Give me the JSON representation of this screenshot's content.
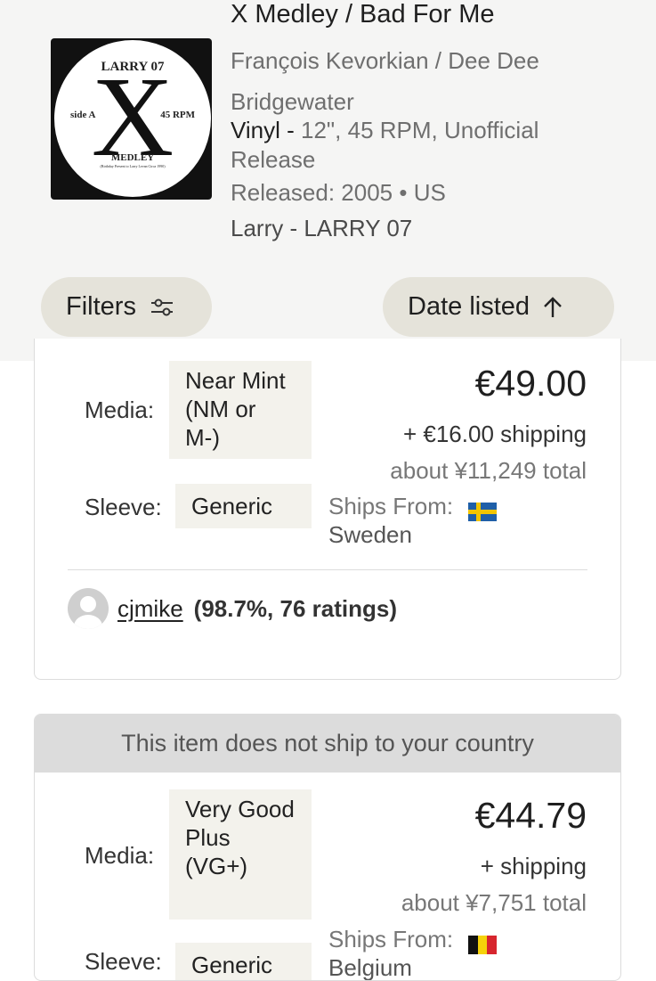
{
  "release": {
    "cover": {
      "catalog": "LARRY 07",
      "letter": "X",
      "side": "side A",
      "rpm": "45 RPM",
      "title": "MEDLEY",
      "fine_print": "(Birthday Present to Larry Levan Circa 1990)"
    },
    "title": "X Medley / Bad For Me",
    "artist_line1": "François Kevorkian / Dee Dee",
    "artist_line2": "Bridgewater",
    "format_main": "Vinyl -",
    "format_rest": "12\", 45 RPM, Unofficial Release",
    "released": "Released: 2005 • US",
    "label": "Larry - LARRY 07"
  },
  "controls": {
    "filters_label": "Filters",
    "filters_icon": "sliders-icon",
    "sort_label": "Date listed",
    "sort_icon": "arrow-up-icon"
  },
  "listings": [
    {
      "media_label": "Media:",
      "media_condition": "Near Mint (NM or M-)",
      "sleeve_label": "Sleeve:",
      "sleeve_condition": "Generic",
      "price": "€49.00",
      "shipping": "+ €16.00 shipping",
      "total": "about ¥11,249 total",
      "ships_from_label": "Ships From:",
      "ships_from_country": "Sweden",
      "flag": "sweden-flag-icon",
      "seller_name": "cjmike",
      "seller_rating": "(98.7%, 76 ratings)"
    },
    {
      "notice": "This item does not ship to your country",
      "media_label": "Media:",
      "media_condition": "Very Good Plus (VG+)",
      "sleeve_label": "Sleeve:",
      "sleeve_condition": "Generic",
      "price": "€44.79",
      "shipping": "+ shipping",
      "total": "about ¥7,751 total",
      "ships_from_label": "Ships From:",
      "ships_from_country": "Belgium",
      "flag": "belgium-flag-icon"
    }
  ],
  "colors": {
    "header_bg": "#f5f5f4",
    "pill_bg": "#e5e3da",
    "condition_bg": "#f3f2ec",
    "notice_bg": "#dcdcdc"
  }
}
